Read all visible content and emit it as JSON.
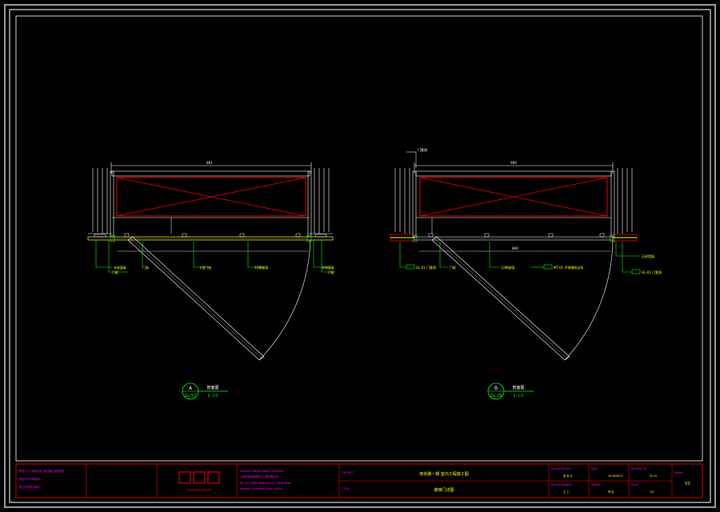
{
  "drawing_a": {
    "overall_dim": "861",
    "bubble_letter": "A",
    "bubble_ref": "GL-57",
    "title": "剖面图",
    "scale": "S: 1/5",
    "labels": {
      "l1": "木饰面板",
      "l2": "门框",
      "l3": "门扇",
      "l4": "L型门档",
      "l5": "12厚玻璃",
      "l6": "木饰面板",
      "l7": "门框"
    }
  },
  "drawing_b": {
    "overall_dim": "900",
    "top_label": "门套线",
    "bubble_letter": "B",
    "bubble_ref": "GL-29",
    "title": "剖面图",
    "scale": "S: 1/5",
    "mid_dim": "800",
    "labels": {
      "l1": "GL-01 门套线",
      "l2": "门框",
      "l3": "12厚玻璃",
      "l4": "MT-01 不锈钢收边条",
      "l5": "石材墙面",
      "l6": "GL-01 门套线"
    }
  },
  "title_block": {
    "notes": "所有尺寸以现场为准 设计图纸 版权所有",
    "notes2": "未经许可不得复制",
    "notes3": "施工前须核对现场",
    "logo_text": "GIG",
    "logo_sub": "INTERIOR DESIGN",
    "company_line1": "Contact: Interior Design Shanghai",
    "company_line2": "上海市室内装饰设计工程有限公司",
    "company_line3": "Tel: 021-6888 8888  Fax: 021-6888 8889",
    "company_line4": "Address: Shanghai China 200000",
    "project_label": "PROJECT",
    "project_name": "南京路一期 室内工程施工图",
    "title_label": "TITLE",
    "drawing_title": "玻璃门详图",
    "design_label": "Design Director",
    "design_value": "张 设 计",
    "project_mgr_label": "Project Designer",
    "project_mgr_value": "王 工",
    "date_label": "Date",
    "date_value": "2014/06/21",
    "drawer_label": "Drawer",
    "drawer_value": "李 绘",
    "dwg_no_label": "Drawing No.",
    "dwg_no_value": "GL-42",
    "scale_label": "Scale",
    "scale_value": "1/5",
    "edition_label": "Edition",
    "edition_value": "V2"
  },
  "colors": {
    "background": "#000000",
    "frame": "#ffffff",
    "door_frame": "#ffffff",
    "panel": "#ff0000",
    "threshold": "#ffff00",
    "leader": "#00ff00",
    "dim_line": "#00ff00",
    "text_magenta": "#ff00ff",
    "text_yellow": "#ffff00",
    "border_red": "#ff0000"
  }
}
